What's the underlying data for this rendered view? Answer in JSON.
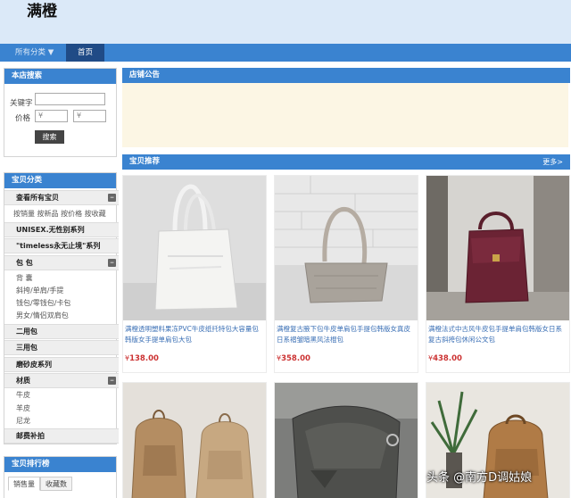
{
  "header": {
    "shop_name": "满橙"
  },
  "nav": {
    "all_categories": "所有分类 ▼",
    "home": "首页"
  },
  "search": {
    "title": "本店搜索",
    "keyword_label": "关键字",
    "price_label": "价格",
    "price_min_placeholder": "¥",
    "price_max_placeholder": "¥",
    "button": "搜索"
  },
  "categories": {
    "title": "宝贝分类",
    "view_all": "查看所有宝贝",
    "sort_options": [
      "按销量",
      "按新品",
      "按价格",
      "按收藏"
    ],
    "groups": [
      {
        "label": "UNISEX.无性别系列"
      },
      {
        "label": "\"timeless永无止境\"系列"
      },
      {
        "label": "包 包",
        "items": [
          "背 囊",
          "斜挎/单肩/手提",
          "钱包/零钱包/卡包",
          "男女/情侣双肩包"
        ]
      },
      {
        "label": "二用包"
      },
      {
        "label": "三用包"
      },
      {
        "label": "磨砂皮系列"
      },
      {
        "label": "材质",
        "items": [
          "牛皮",
          "羊皮",
          "尼龙"
        ]
      },
      {
        "label": "邮费补拍"
      }
    ]
  },
  "ranking": {
    "title": "宝贝排行榜",
    "tabs": [
      "销售量",
      "收藏数"
    ]
  },
  "notice": {
    "title": "店铺公告"
  },
  "recommend": {
    "title": "宝贝推荐",
    "more": "更多>",
    "products": [
      {
        "title": "满橙透明塑料果冻PVC牛皮纸托特包大容量包韩版女手提单肩包大包",
        "currency": "¥",
        "price": "138.00"
      },
      {
        "title": "满橙复古腋下包牛皮单肩包手提包韩版女真皮日系褶皱暗黑风法棍包",
        "currency": "¥",
        "price": "358.00"
      },
      {
        "title": "满橙法式中古风牛皮包手提单肩包韩版女日系复古斜挎包休闲公文包",
        "currency": "¥",
        "price": "438.00"
      },
      {
        "title": "",
        "currency": "",
        "price": ""
      },
      {
        "title": "",
        "currency": "",
        "price": ""
      },
      {
        "title": "",
        "currency": "",
        "price": ""
      }
    ]
  },
  "watermark": "头条 @南方D调姑娘"
}
